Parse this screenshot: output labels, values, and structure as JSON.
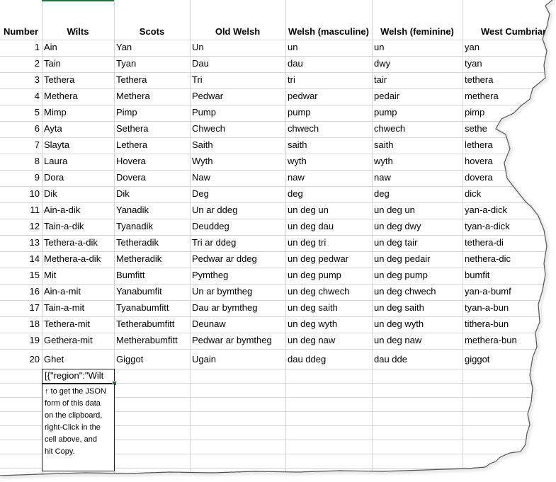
{
  "headers": [
    "Number",
    "Wilts",
    "Scots",
    "Old Welsh",
    "Welsh (masculine)",
    "Welsh (feminine)",
    "West Cumbrian"
  ],
  "rows": [
    [
      "1",
      "Ain",
      "Yan",
      "Un",
      "un",
      "un",
      "yan"
    ],
    [
      "2",
      "Tain",
      "Tyan",
      "Dau",
      "dau",
      "dwy",
      "tyan"
    ],
    [
      "3",
      "Tethera",
      "Tethera",
      "Tri",
      "tri",
      "tair",
      "tethera"
    ],
    [
      "4",
      "Methera",
      "Methera",
      "Pedwar",
      "pedwar",
      "pedair",
      "methera"
    ],
    [
      "5",
      "Mimp",
      "Pimp",
      "Pump",
      "pump",
      "pump",
      "pimp"
    ],
    [
      "6",
      "Ayta",
      "Sethera",
      "Chwech",
      "chwech",
      "chwech",
      "sethe"
    ],
    [
      "7",
      "Slayta",
      "Lethera",
      "Saith",
      "saith",
      "saith",
      "lethera"
    ],
    [
      "8",
      "Laura",
      "Hovera",
      "Wyth",
      "wyth",
      "wyth",
      "hovera"
    ],
    [
      "9",
      "Dora",
      "Dovera",
      "Naw",
      "naw",
      "naw",
      "dovera"
    ],
    [
      "10",
      "Dik",
      "Dik",
      "Deg",
      "deg",
      "deg",
      "dick"
    ],
    [
      "11",
      "Ain-a-dik",
      "Yanadik",
      "Un ar ddeg",
      "un deg un",
      "un deg un",
      "yan-a-dick"
    ],
    [
      "12",
      "Tain-a-dik",
      "Tyanadik",
      "Deuddeg",
      "un deg dau",
      "un deg dwy",
      "tyan-a-dick"
    ],
    [
      "13",
      "Tethera-a-dik",
      "Tetheradik",
      "Tri ar ddeg",
      "un deg tri",
      "un deg tair",
      "tethera-di"
    ],
    [
      "14",
      "Methera-a-dik",
      "Metheradik",
      "Pedwar ar ddeg",
      "un deg pedwar",
      "un deg pedair",
      "nethera-dic"
    ],
    [
      "15",
      "Mit",
      "Bumfitt",
      "Pymtheg",
      "un deg pump",
      "un deg pump",
      "bumfit"
    ],
    [
      "16",
      "Ain-a-mit",
      "Yanabumfit",
      "Un ar bymtheg",
      "un deg chwech",
      "un deg chwech",
      "yan-a-bumf"
    ],
    [
      "17",
      "Tain-a-mit",
      "Tyanabumfitt",
      "Dau ar bymtheg",
      "un deg saith",
      "un deg saith",
      "tyan-a-bun"
    ],
    [
      "18",
      "Tethera-mit",
      "Tetherabumfitt",
      "Deunaw",
      "un deg wyth",
      "un deg wyth",
      "tithera-bun"
    ],
    [
      "19",
      "Gethera-mit",
      "Metherabumfitt",
      "Pedwar ar bymtheg",
      "un deg naw",
      "un deg naw",
      "methera-bun"
    ],
    [
      "20",
      "Ghet",
      "Giggot",
      "Ugain",
      "dau ddeg",
      "dau dde",
      "giggot"
    ]
  ],
  "selected_cell_value": "[{\"region\":\"Wilt",
  "comment_text": "↑ to get the JSON\nform of this data\non the clipboard,\nright-Click in the\ncell above, and\nhit Copy.",
  "colors": {
    "gridline": "#d4d4d4",
    "accent": "#217346",
    "text": "#000000"
  }
}
